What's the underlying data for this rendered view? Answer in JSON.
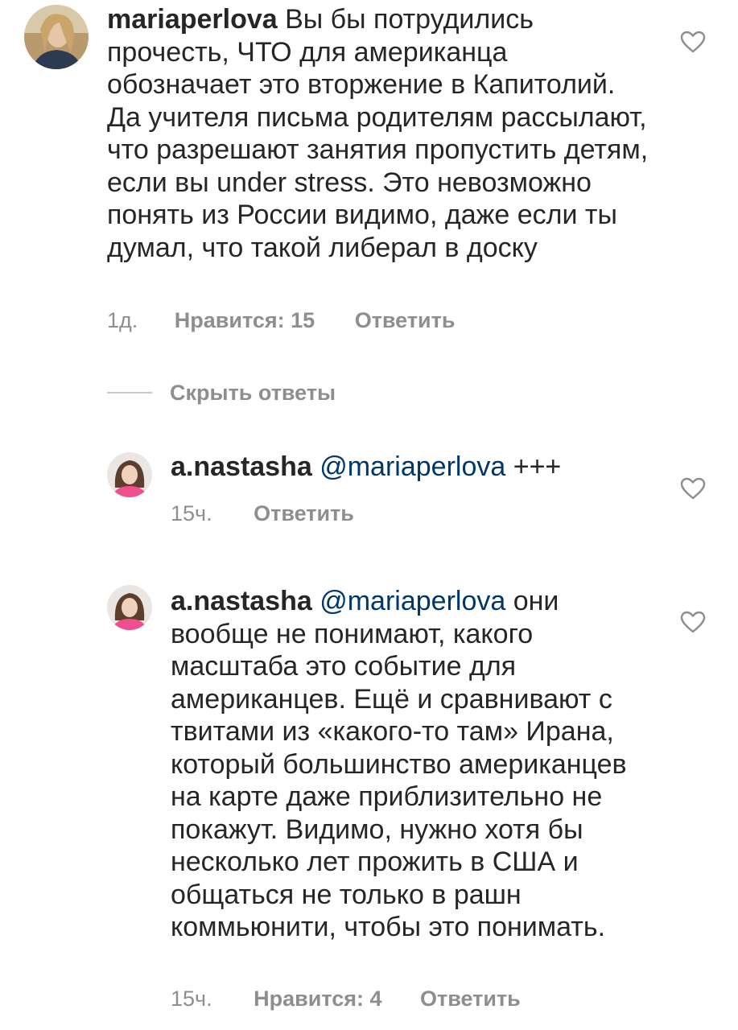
{
  "comments": [
    {
      "username": "mariaperlova",
      "text": " Вы бы потрудились прочесть, ЧТО для американца обозначает это вторжение в Капитолий. Да учителя письма родителям рассылают, что разрешают занятия пропустить детям, если вы under stress. Это невозможно понять из России видимо, даже если ты думал, что такой либерал в доску",
      "time": "1д.",
      "likes": "Нравится: 15",
      "reply": "Ответить",
      "like_icon": "heart-outline-icon"
    }
  ],
  "hide_replies": "Скрыть ответы",
  "replies": [
    {
      "username": "a.nastasha",
      "mention": "@mariaperlova",
      "text": " +++",
      "time": "15ч.",
      "reply": "Ответить",
      "like_icon": "heart-outline-icon"
    },
    {
      "username": "a.nastasha",
      "mention": "@mariaperlova",
      "text": " они вообще не понимают, какого масштаба это событие для американцев. Ещё и сравнивают с твитами из «какого-то там» Ирана, который большинство американцев на карте даже приблизительно не покажут. Видимо, нужно хотя бы несколько лет прожить в США и общаться не только в рашн коммьюнити, чтобы это понимать.",
      "time": "15ч.",
      "likes": "Нравится: 4",
      "reply": "Ответить",
      "like_icon": "heart-outline-icon"
    }
  ],
  "colors": {
    "text": "#262626",
    "secondary": "#8e8e8e",
    "mention": "#00376b",
    "divider": "#c7c7c7"
  }
}
